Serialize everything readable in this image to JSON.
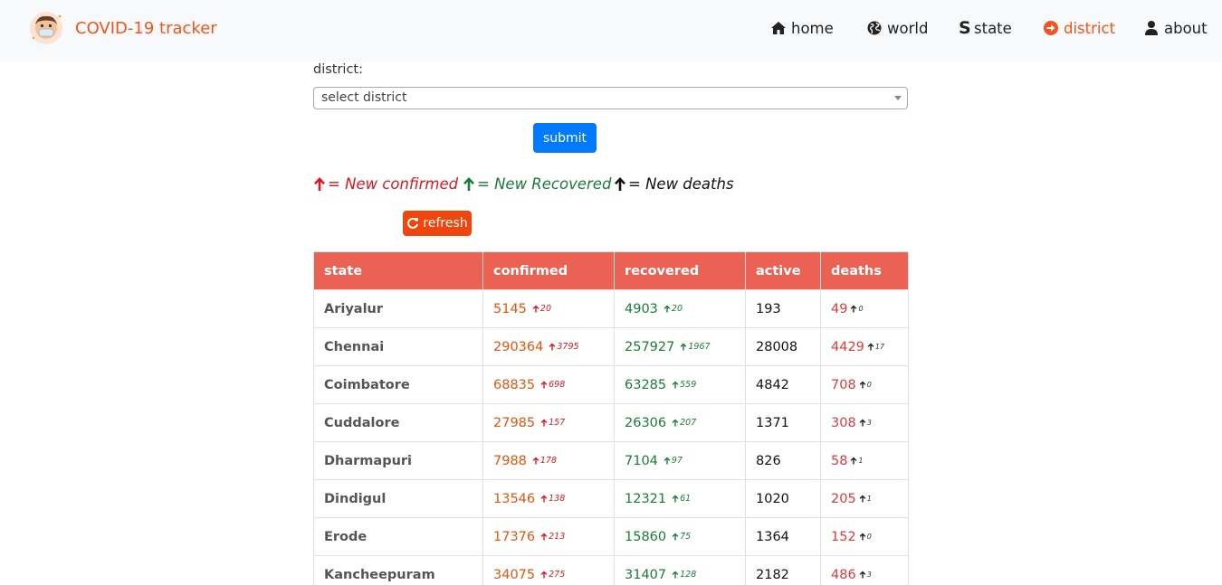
{
  "brand": {
    "title": "COVID-19 tracker"
  },
  "nav": {
    "home": "home",
    "world": "world",
    "state": "state",
    "district": "district",
    "about": "about"
  },
  "form": {
    "label": "district:",
    "select_value": "select district",
    "submit_label": "submit"
  },
  "legend": {
    "confirmed": "= New confirmed",
    "recovered": "= New Recovered",
    "deaths": "= New deaths"
  },
  "refresh_label": "refresh",
  "colors": {
    "brand": "#f2541b",
    "header_bg": "#eb6153",
    "confirmed": "#e6550d",
    "recovered": "#1b7c37",
    "deaths": "#e03b3b",
    "submit": "#007bff",
    "refresh": "#f0460d"
  },
  "table": {
    "headers": [
      "state",
      "confirmed",
      "recovered",
      "active",
      "deaths"
    ],
    "rows": [
      {
        "state": "Ariyalur",
        "confirmed": "5145",
        "new_confirmed": "20",
        "recovered": "4903",
        "new_recovered": "20",
        "active": "193",
        "deaths": "49",
        "new_deaths": "0"
      },
      {
        "state": "Chennai",
        "confirmed": "290364",
        "new_confirmed": "3795",
        "recovered": "257927",
        "new_recovered": "1967",
        "active": "28008",
        "deaths": "4429",
        "new_deaths": "17"
      },
      {
        "state": "Coimbatore",
        "confirmed": "68835",
        "new_confirmed": "698",
        "recovered": "63285",
        "new_recovered": "559",
        "active": "4842",
        "deaths": "708",
        "new_deaths": "0"
      },
      {
        "state": "Cuddalore",
        "confirmed": "27985",
        "new_confirmed": "157",
        "recovered": "26306",
        "new_recovered": "207",
        "active": "1371",
        "deaths": "308",
        "new_deaths": "3"
      },
      {
        "state": "Dharmapuri",
        "confirmed": "7988",
        "new_confirmed": "178",
        "recovered": "7104",
        "new_recovered": "97",
        "active": "826",
        "deaths": "58",
        "new_deaths": "1"
      },
      {
        "state": "Dindigul",
        "confirmed": "13546",
        "new_confirmed": "138",
        "recovered": "12321",
        "new_recovered": "61",
        "active": "1020",
        "deaths": "205",
        "new_deaths": "1"
      },
      {
        "state": "Erode",
        "confirmed": "17376",
        "new_confirmed": "213",
        "recovered": "15860",
        "new_recovered": "75",
        "active": "1364",
        "deaths": "152",
        "new_deaths": "0"
      },
      {
        "state": "Kancheepuram",
        "confirmed": "34075",
        "new_confirmed": "275",
        "recovered": "31407",
        "new_recovered": "128",
        "active": "2182",
        "deaths": "486",
        "new_deaths": "3"
      }
    ]
  }
}
